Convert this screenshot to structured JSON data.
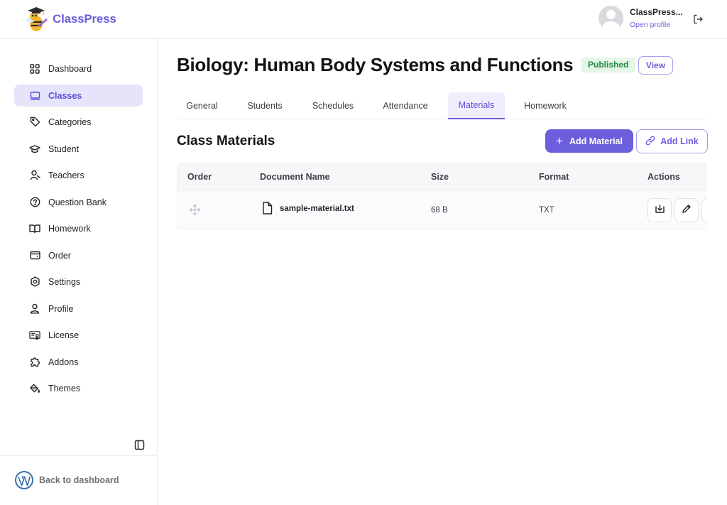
{
  "brand": {
    "name": "ClassPress",
    "accent": "#6b5fdc"
  },
  "user": {
    "name": "ClassPress...",
    "link": "Open profile"
  },
  "sidebar": {
    "items": [
      {
        "label": "Dashboard",
        "icon": "grid-icon",
        "active": false
      },
      {
        "label": "Classes",
        "icon": "monitor-icon",
        "active": true
      },
      {
        "label": "Categories",
        "icon": "tag-icon",
        "active": false
      },
      {
        "label": "Student",
        "icon": "graduation-cap-icon",
        "active": false
      },
      {
        "label": "Teachers",
        "icon": "teacher-icon",
        "active": false
      },
      {
        "label": "Question Bank",
        "icon": "question-circle-icon",
        "active": false
      },
      {
        "label": "Homework",
        "icon": "book-open-icon",
        "active": false
      },
      {
        "label": "Order",
        "icon": "wallet-icon",
        "active": false
      },
      {
        "label": "Settings",
        "icon": "gear-icon",
        "active": false
      },
      {
        "label": "Profile",
        "icon": "user-icon",
        "active": false
      },
      {
        "label": "License",
        "icon": "certificate-icon",
        "active": false
      },
      {
        "label": "Addons",
        "icon": "puzzle-icon",
        "active": false
      },
      {
        "label": "Themes",
        "icon": "paint-bucket-icon",
        "active": false
      }
    ],
    "back_label": "Back to dashboard"
  },
  "page": {
    "title": "Biology: Human Body Systems and Functions",
    "status": "Published",
    "view_label": "View"
  },
  "tabs": [
    "General",
    "Students",
    "Schedules",
    "Attendance",
    "Materials",
    "Homework"
  ],
  "active_tab": "Materials",
  "materials": {
    "title": "Class Materials",
    "add_material_label": "Add Material",
    "add_link_label": "Add Link",
    "columns": [
      "Order",
      "Document Name",
      "Size",
      "Format",
      "Actions"
    ],
    "rows": [
      {
        "name": "sample-material.txt",
        "size": "68 B",
        "format": "TXT"
      }
    ]
  }
}
